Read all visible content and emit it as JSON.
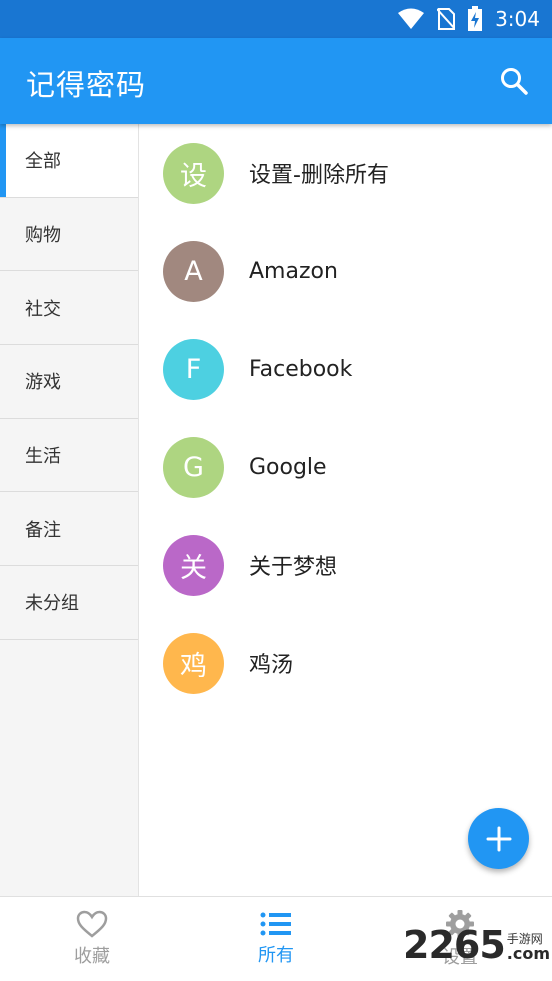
{
  "status_bar": {
    "time": "3:04"
  },
  "app_bar": {
    "title": "记得密码"
  },
  "sidebar": {
    "items": [
      {
        "label": "全部",
        "active": true
      },
      {
        "label": "购物"
      },
      {
        "label": "社交"
      },
      {
        "label": "游戏"
      },
      {
        "label": "生活"
      },
      {
        "label": "备注"
      },
      {
        "label": "未分组"
      }
    ]
  },
  "entries": [
    {
      "initial": "设",
      "label": "设置-删除所有",
      "color": "#AED581"
    },
    {
      "initial": "A",
      "label": "Amazon",
      "color": "#A1887F"
    },
    {
      "initial": "F",
      "label": "Facebook",
      "color": "#4DD0E1"
    },
    {
      "initial": "G",
      "label": "Google",
      "color": "#AED581"
    },
    {
      "initial": "关",
      "label": "关于梦想",
      "color": "#BA68C8"
    },
    {
      "initial": "鸡",
      "label": "鸡汤",
      "color": "#FFB74D"
    }
  ],
  "bottom_nav": {
    "items": [
      {
        "label": "收藏",
        "icon": "heart-icon"
      },
      {
        "label": "所有",
        "icon": "list-icon",
        "active": true
      },
      {
        "label": "设置",
        "icon": "gear-icon"
      }
    ]
  },
  "watermark": {
    "number": "2265",
    "cn": "手游网",
    "suffix": ".com"
  },
  "colors": {
    "primary": "#2196F3",
    "primary_dark": "#1976D2"
  }
}
